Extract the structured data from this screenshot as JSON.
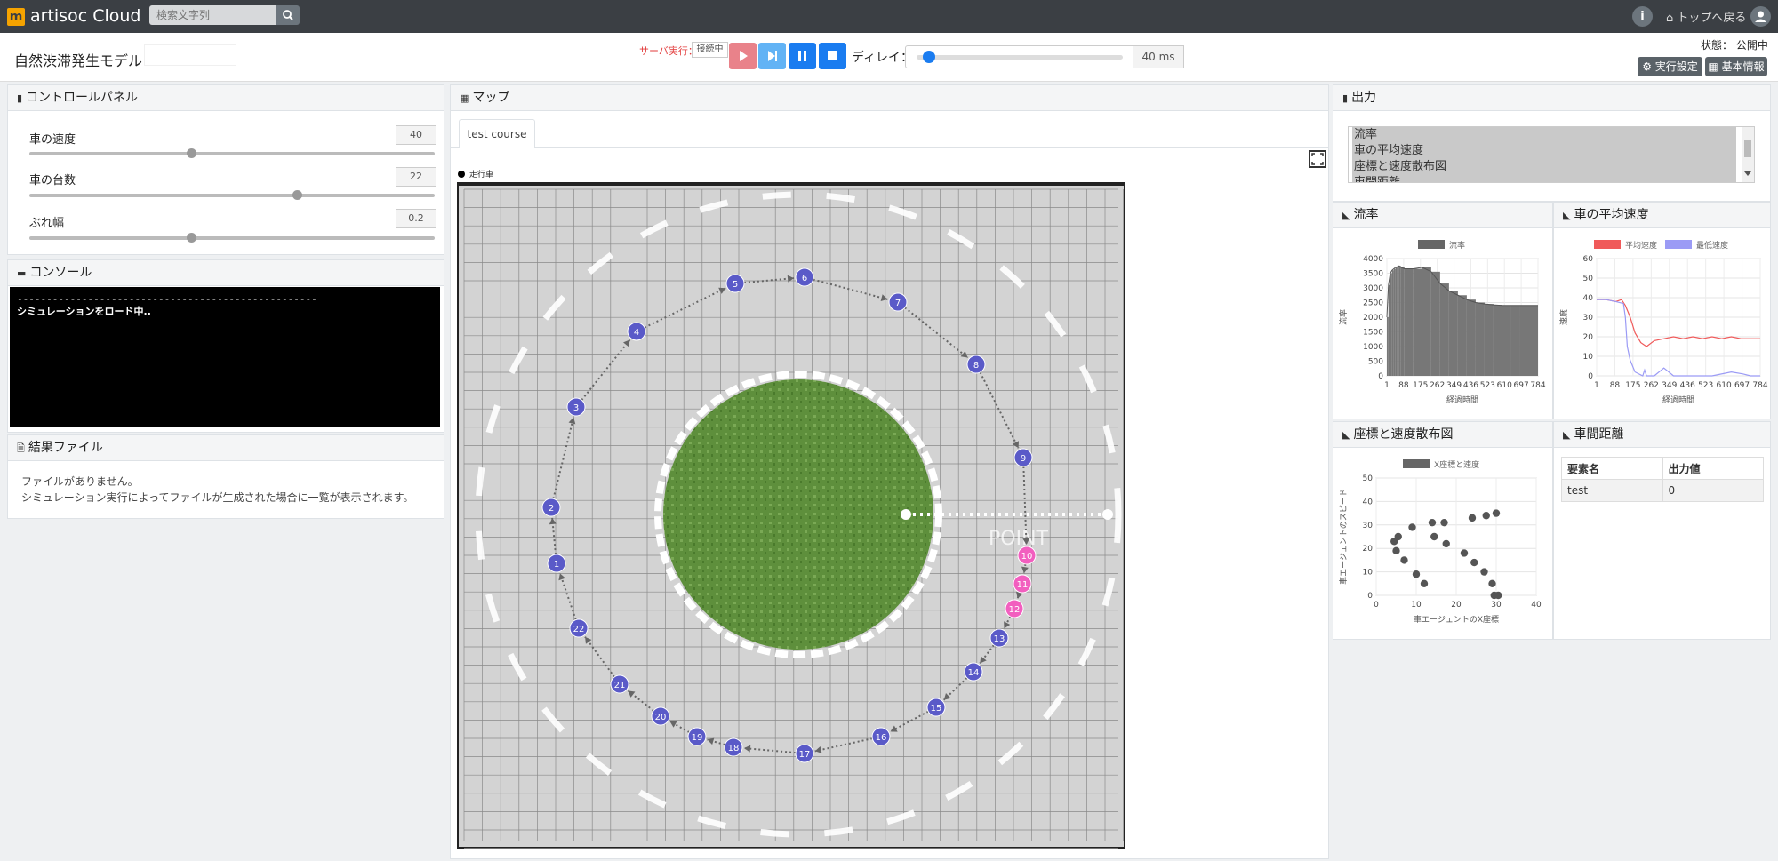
{
  "nav": {
    "brand": "artisoc Cloud",
    "logo_char": "m",
    "search_placeholder": "検索文字列",
    "home_link": "トップへ戻る",
    "info_label": "i"
  },
  "header": {
    "model_title": "自然渋滞発生モデル",
    "server_label": "サーバ実行：",
    "server_status": "接続中",
    "delay_label": "ディレイ：",
    "delay_value": "40 ms",
    "delay_level": 0.03,
    "state_label": "状態：",
    "state_value": "公開中",
    "run_settings_btn": "実行設定",
    "basic_info_btn": "基本情報"
  },
  "control_panel": {
    "title": "コントロールパネル",
    "sliders": [
      {
        "label": "車の速度",
        "value": "40",
        "level": 0.4
      },
      {
        "label": "車の台数",
        "value": "22",
        "level": 0.66
      },
      {
        "label": "ぶれ幅",
        "value": "0.2",
        "level": 0.4
      }
    ]
  },
  "console": {
    "title": "コンソール",
    "line1": "---------------------------------------------------",
    "line2": "シミュレーションをロード中.."
  },
  "results": {
    "title": "結果ファイル",
    "line1": "ファイルがありません。",
    "line2": "シミュレーション実行によってファイルが生成された場合に一覧が表示されます。"
  },
  "map": {
    "title": "マップ",
    "tab": "test course",
    "legend": "走行車",
    "point_label": "POINT",
    "agents": [
      {
        "n": "1",
        "pink": false
      },
      {
        "n": "2",
        "pink": false
      },
      {
        "n": "3",
        "pink": false
      },
      {
        "n": "4",
        "pink": false
      },
      {
        "n": "5",
        "pink": false
      },
      {
        "n": "6",
        "pink": false
      },
      {
        "n": "7",
        "pink": false
      },
      {
        "n": "8",
        "pink": false
      },
      {
        "n": "9",
        "pink": false
      },
      {
        "n": "10",
        "pink": true
      },
      {
        "n": "11",
        "pink": true
      },
      {
        "n": "12",
        "pink": true
      },
      {
        "n": "13",
        "pink": false
      },
      {
        "n": "14",
        "pink": false
      },
      {
        "n": "15",
        "pink": false
      },
      {
        "n": "16",
        "pink": false
      },
      {
        "n": "17",
        "pink": false
      },
      {
        "n": "18",
        "pink": false
      },
      {
        "n": "19",
        "pink": false
      },
      {
        "n": "20",
        "pink": false
      },
      {
        "n": "21",
        "pink": false
      },
      {
        "n": "22",
        "pink": false
      }
    ]
  },
  "output": {
    "title": "出力",
    "list": [
      "流率",
      "車の平均速度",
      "座標と速度散布図",
      "車間距離"
    ],
    "table": {
      "title": "車間距離",
      "headers": [
        "要素名",
        "出力値"
      ],
      "rows": [
        [
          "test",
          "0"
        ]
      ]
    }
  },
  "chart_data": [
    {
      "type": "bar",
      "title": "流率",
      "series": [
        {
          "name": "流率",
          "color": "#666666"
        }
      ],
      "xlabel": "経過時間",
      "ylabel": "流率",
      "ylim": [
        0,
        4000
      ],
      "y_ticks": [
        "4000",
        "3500",
        "3000",
        "2500",
        "2000",
        "1500",
        "1000",
        "500",
        "0"
      ],
      "x_ticks": [
        "1",
        "88",
        "175",
        "262",
        "349",
        "436",
        "523",
        "610",
        "697",
        "784"
      ],
      "x": [
        1,
        10,
        20,
        30,
        40,
        50,
        60,
        70,
        80,
        100,
        150,
        200,
        250,
        300,
        350,
        400,
        450,
        500,
        550,
        600,
        650,
        700,
        750,
        784,
        850
      ],
      "values": [
        2000,
        3100,
        3500,
        3600,
        3650,
        3700,
        3720,
        3750,
        3700,
        3650,
        3650,
        3700,
        3550,
        3150,
        2900,
        2750,
        2600,
        2500,
        2450,
        2420,
        2400,
        2400,
        2400,
        2400,
        2400
      ]
    },
    {
      "type": "line",
      "title": "車の平均速度",
      "xlabel": "経過時間",
      "ylabel": "速度",
      "ylim": [
        0,
        60
      ],
      "y_ticks": [
        "60",
        "50",
        "40",
        "30",
        "20",
        "10",
        "0"
      ],
      "x_ticks": [
        "1",
        "88",
        "175",
        "262",
        "349",
        "436",
        "523",
        "610",
        "697",
        "784"
      ],
      "series": [
        {
          "name": "平均速度",
          "color": "#f05a5a",
          "x": [
            1,
            50,
            100,
            130,
            150,
            175,
            200,
            230,
            260,
            300,
            350,
            400,
            450,
            500,
            550,
            600,
            650,
            700,
            750,
            800,
            850
          ],
          "values": [
            39,
            39,
            38,
            39,
            36,
            30,
            22,
            17,
            15,
            18,
            19,
            20,
            19,
            20,
            19,
            20,
            19,
            20,
            19,
            19,
            19
          ]
        },
        {
          "name": "最低速度",
          "color": "#9b9bf5",
          "x": [
            1,
            50,
            100,
            140,
            150,
            160,
            175,
            200,
            240,
            250,
            260,
            300,
            350,
            400,
            500,
            600,
            700,
            760,
            800,
            850
          ],
          "values": [
            39,
            39,
            38,
            37,
            30,
            15,
            8,
            2,
            0,
            3,
            0,
            0,
            4,
            0,
            0,
            0,
            2,
            1,
            0,
            0
          ]
        }
      ]
    },
    {
      "type": "scatter",
      "title": "座標と速度散布図",
      "series": [
        {
          "name": "X座標と速度",
          "color": "#666666"
        }
      ],
      "xlabel": "車エージェントのX座標",
      "ylabel": "車エージェントのスピード",
      "xlim": [
        0,
        40
      ],
      "ylim": [
        0,
        50
      ],
      "x_ticks": [
        "0",
        "10",
        "20",
        "30",
        "40"
      ],
      "y_ticks": [
        "50",
        "40",
        "30",
        "20",
        "10",
        "0"
      ],
      "points": [
        [
          4.5,
          23
        ],
        [
          5.5,
          25
        ],
        [
          5,
          19
        ],
        [
          7,
          15
        ],
        [
          9,
          29
        ],
        [
          10,
          9
        ],
        [
          12,
          5
        ],
        [
          14,
          31
        ],
        [
          14.5,
          25
        ],
        [
          17,
          31
        ],
        [
          17.5,
          22
        ],
        [
          22,
          18
        ],
        [
          24,
          33
        ],
        [
          24.5,
          14
        ],
        [
          27,
          10
        ],
        [
          27.5,
          34
        ],
        [
          29,
          5
        ],
        [
          30,
          35
        ],
        [
          29.5,
          0
        ],
        [
          30.5,
          0
        ]
      ]
    }
  ]
}
